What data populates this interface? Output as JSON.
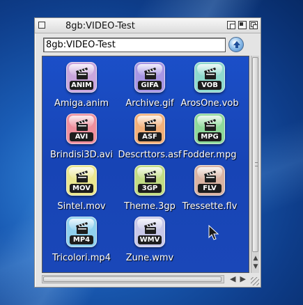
{
  "window": {
    "title": "8gb:VIDEO-Test",
    "path": "8gb:VIDEO-Test"
  },
  "files": [
    {
      "name": "Amiga.anim",
      "format": "ANIM",
      "color": "#c9a6dc"
    },
    {
      "name": "Archive.gif",
      "format": "GIFA",
      "color": "#a796e3"
    },
    {
      "name": "ArosOne.vob",
      "format": "VOB",
      "color": "#8fd9cd"
    },
    {
      "name": "Brindisi3D.avi",
      "format": "AVI",
      "color": "#ee8f9d"
    },
    {
      "name": "Descrttors.asf",
      "format": "ASF",
      "color": "#f2b07a"
    },
    {
      "name": "Fodder.mpg",
      "format": "MPG",
      "color": "#8ed89a"
    },
    {
      "name": "Sintel.mov",
      "format": "MOV",
      "color": "#e9e68f"
    },
    {
      "name": "Theme.3gp",
      "format": "3GP",
      "color": "#c2dc84"
    },
    {
      "name": "Tressette.flv",
      "format": "FLV",
      "color": "#d9b3a3"
    },
    {
      "name": "Tricolori.mp4",
      "format": "MP4",
      "color": "#8fd0ee"
    },
    {
      "name": "Zune.wmv",
      "format": "WMV",
      "color": "#c8c8e8"
    }
  ]
}
